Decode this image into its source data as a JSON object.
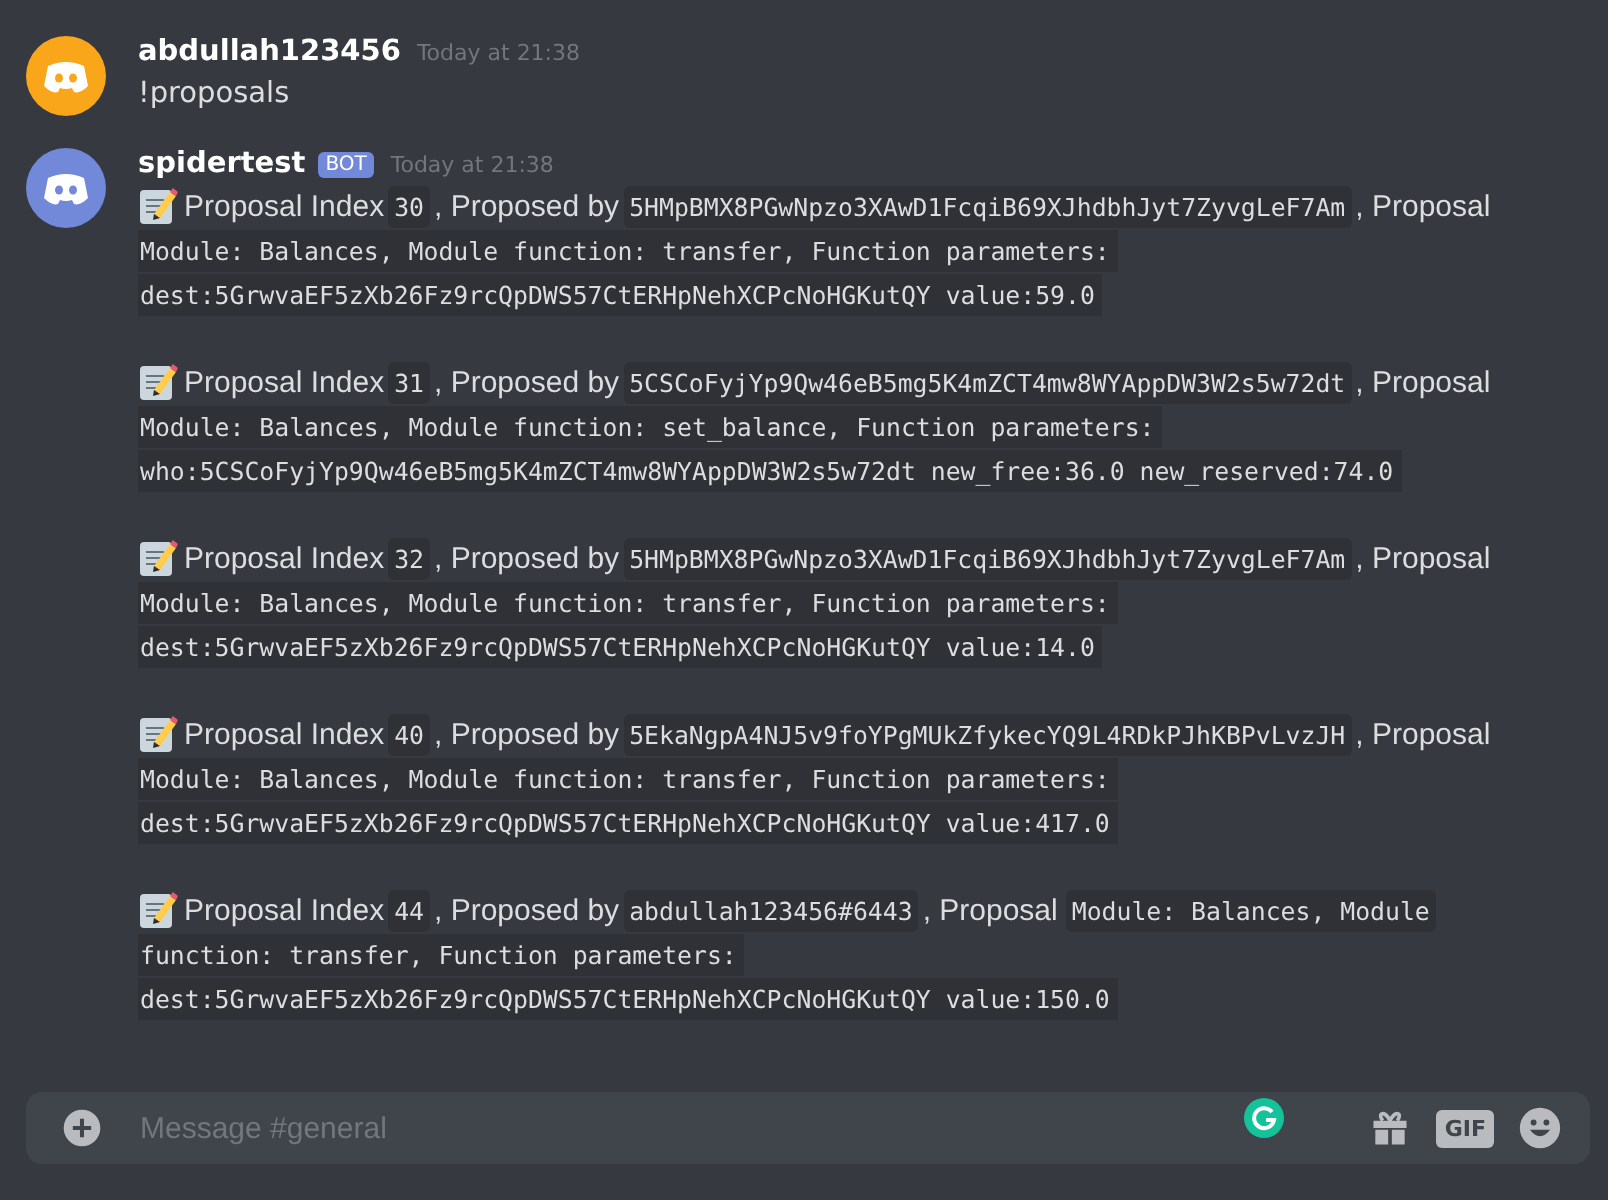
{
  "messages": [
    {
      "author": "abdullah123456",
      "color": "#faa61a",
      "bot": false,
      "timestamp": "Today at 21:38",
      "text": "!proposals"
    },
    {
      "author": "spidertest",
      "color": "#7289da",
      "bot": true,
      "bot_label": "BOT",
      "timestamp": "Today at 21:38",
      "proposals": [
        {
          "label": "Proposal Index",
          "index": "30",
          "proposed_by_label": ", Proposed by",
          "proposer": "5HMpBMX8PGwNpzo3XAwD1FcqiB69XJhdbhJyt7ZyvgLeF7Am",
          "proposal_label": ", Proposal",
          "details_inline": false,
          "details": [
            "Module: Balances, Module function: transfer, Function parameters:",
            "dest:5GrwvaEF5zXb26Fz9rcQpDWS57CtERHpNehXCPcNoHGKutQY value:59.0"
          ]
        },
        {
          "label": "Proposal Index",
          "index": "31",
          "proposed_by_label": ", Proposed by",
          "proposer": "5CSCoFyjYp9Qw46eB5mg5K4mZCT4mw8WYAppDW3W2s5w72dt",
          "proposal_label": ", Proposal",
          "details_inline": false,
          "details": [
            "Module: Balances, Module function: set_balance, Function parameters:",
            "who:5CSCoFyjYp9Qw46eB5mg5K4mZCT4mw8WYAppDW3W2s5w72dt new_free:36.0 new_reserved:74.0"
          ]
        },
        {
          "label": "Proposal Index",
          "index": "32",
          "proposed_by_label": ", Proposed by",
          "proposer": "5HMpBMX8PGwNpzo3XAwD1FcqiB69XJhdbhJyt7ZyvgLeF7Am",
          "proposal_label": ", Proposal",
          "details_inline": false,
          "details": [
            "Module: Balances, Module function: transfer, Function parameters:",
            "dest:5GrwvaEF5zXb26Fz9rcQpDWS57CtERHpNehXCPcNoHGKutQY value:14.0"
          ]
        },
        {
          "label": "Proposal Index",
          "index": "40",
          "proposed_by_label": ", Proposed by",
          "proposer": "5EkaNgpA4NJ5v9foYPgMUkZfykecYQ9L4RDkPJhKBPvLvzJH",
          "proposal_label": ", Proposal",
          "details_inline": false,
          "details": [
            "Module: Balances, Module function: transfer, Function parameters:",
            "dest:5GrwvaEF5zXb26Fz9rcQpDWS57CtERHpNehXCPcNoHGKutQY value:417.0"
          ]
        },
        {
          "label": "Proposal Index",
          "index": "44",
          "proposed_by_label": ", Proposed by",
          "proposer": "abdullah123456#6443",
          "proposal_label": ", Proposal",
          "details_inline": true,
          "details": [
            "Module: Balances, Module",
            "function: transfer, Function parameters:",
            "dest:5GrwvaEF5zXb26Fz9rcQpDWS57CtERHpNehXCPcNoHGKutQY value:150.0"
          ]
        }
      ]
    }
  ],
  "composer": {
    "placeholder": "Message #general",
    "gif_label": "GIF"
  }
}
